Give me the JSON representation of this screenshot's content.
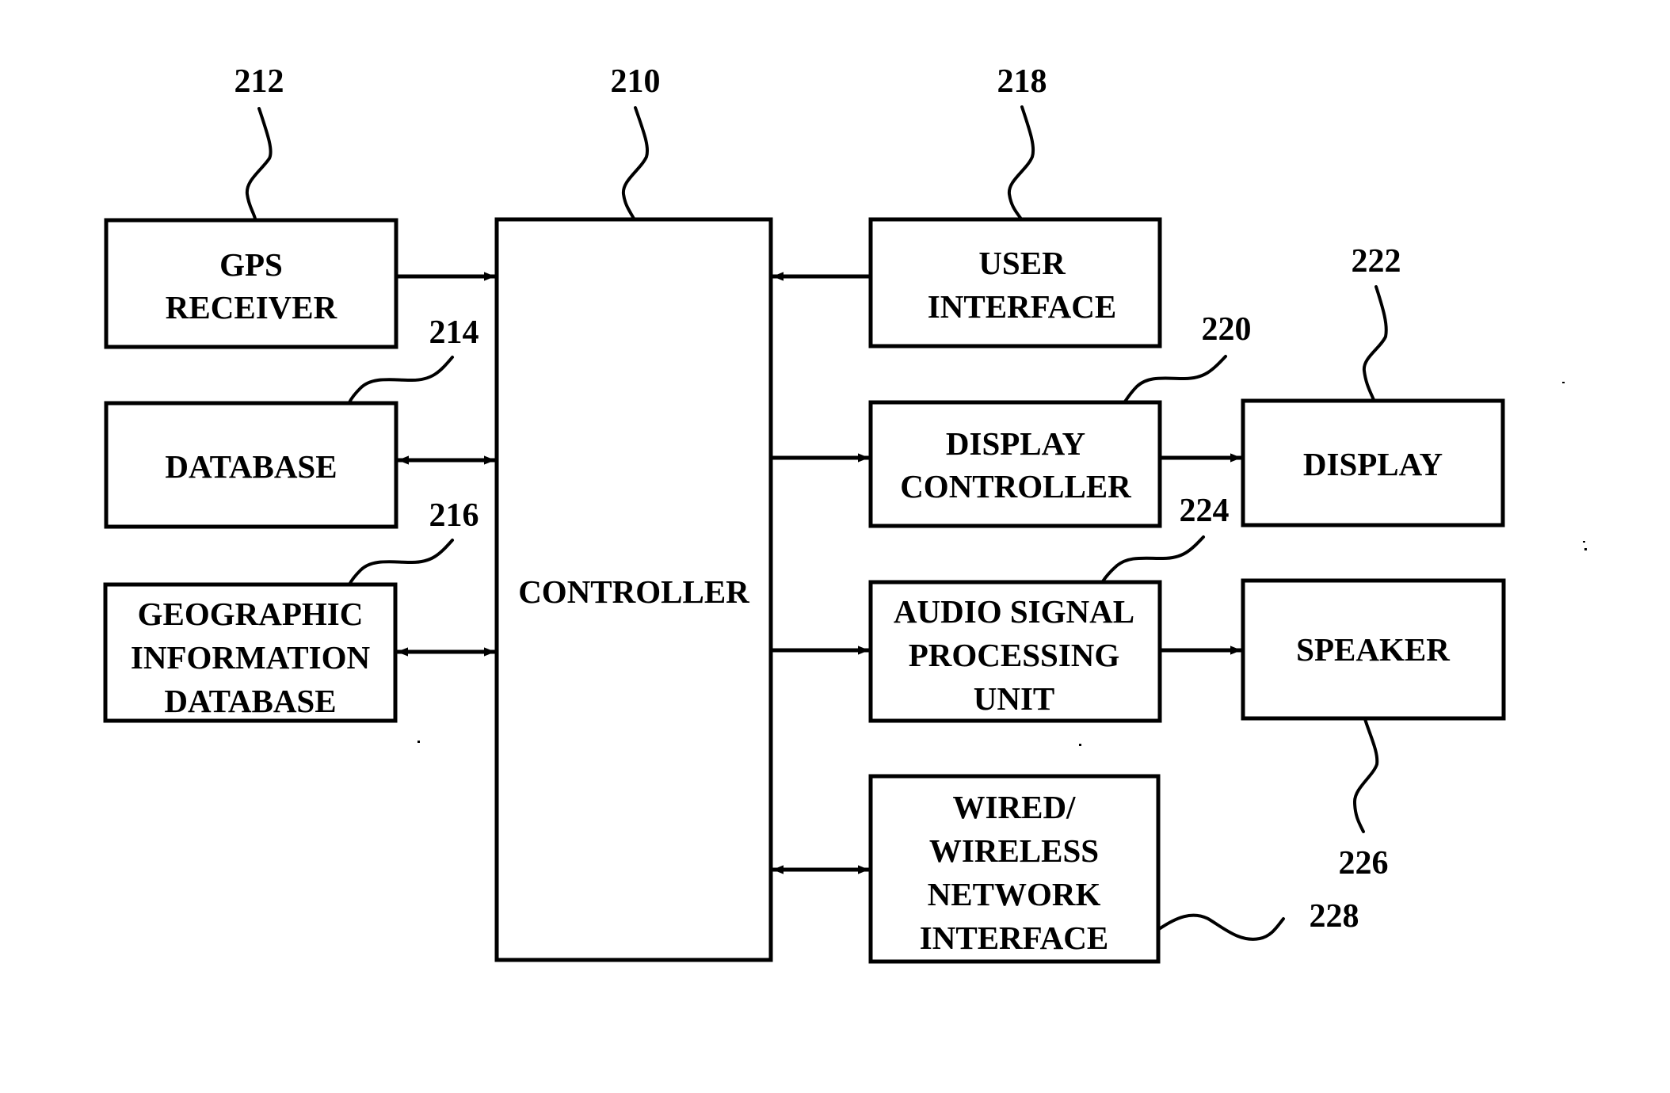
{
  "diagram": {
    "blocks": {
      "controller": {
        "ref": "210",
        "lines": [
          "CONTROLLER"
        ]
      },
      "gps": {
        "ref": "212",
        "lines": [
          "GPS",
          "RECEIVER"
        ]
      },
      "database": {
        "ref": "214",
        "lines": [
          "DATABASE"
        ]
      },
      "geo_db": {
        "ref": "216",
        "lines": [
          "GEOGRAPHIC",
          "INFORMATION",
          "DATABASE"
        ]
      },
      "user_interface": {
        "ref": "218",
        "lines": [
          "USER",
          "INTERFACE"
        ]
      },
      "display_controller": {
        "ref": "220",
        "lines": [
          "DISPLAY",
          "CONTROLLER"
        ]
      },
      "display": {
        "ref": "222",
        "lines": [
          "DISPLAY"
        ]
      },
      "audio": {
        "ref": "224",
        "lines": [
          "AUDIO SIGNAL",
          "PROCESSING",
          "UNIT"
        ]
      },
      "speaker": {
        "ref": "226",
        "lines": [
          "SPEAKER"
        ]
      },
      "network": {
        "ref": "228",
        "lines": [
          "WIRED/",
          "WIRELESS",
          "NETWORK",
          "INTERFACE"
        ]
      }
    },
    "connections": [
      {
        "from": "gps",
        "to": "controller",
        "direction": "one-way"
      },
      {
        "from": "database",
        "to": "controller",
        "direction": "bidirectional"
      },
      {
        "from": "geo_db",
        "to": "controller",
        "direction": "bidirectional"
      },
      {
        "from": "user_interface",
        "to": "controller",
        "direction": "one-way"
      },
      {
        "from": "controller",
        "to": "display_controller",
        "direction": "one-way"
      },
      {
        "from": "display_controller",
        "to": "display",
        "direction": "one-way"
      },
      {
        "from": "controller",
        "to": "audio",
        "direction": "one-way"
      },
      {
        "from": "audio",
        "to": "speaker",
        "direction": "one-way"
      },
      {
        "from": "controller",
        "to": "network",
        "direction": "bidirectional"
      }
    ]
  }
}
